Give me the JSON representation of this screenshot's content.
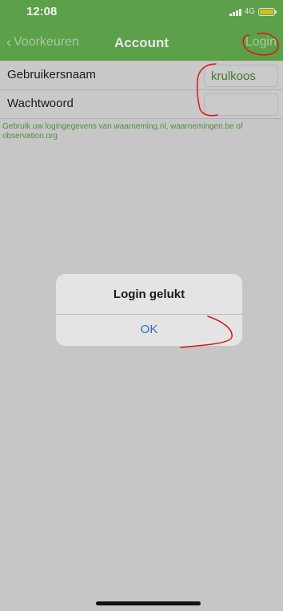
{
  "status": {
    "time": "12:08",
    "network": "4G"
  },
  "nav": {
    "back_label": "Voorkeuren",
    "title": "Account",
    "login_label": "Login"
  },
  "form": {
    "username_label": "Gebruikersnaam",
    "username_value": "krulkoos",
    "password_label": "Wachtwoord",
    "password_value": ""
  },
  "hint": "Gebruik uw logingegevens van waarneming.nl, waarnemingen.be of observation.org",
  "alert": {
    "title": "Login gelukt",
    "ok_label": "OK"
  },
  "colors": {
    "brand_green": "#5ca04a",
    "link_blue": "#2a6fd0",
    "annotation_red": "#e0141a"
  },
  "icons": [
    "chevron-left-icon",
    "signal-icon",
    "battery-icon"
  ]
}
